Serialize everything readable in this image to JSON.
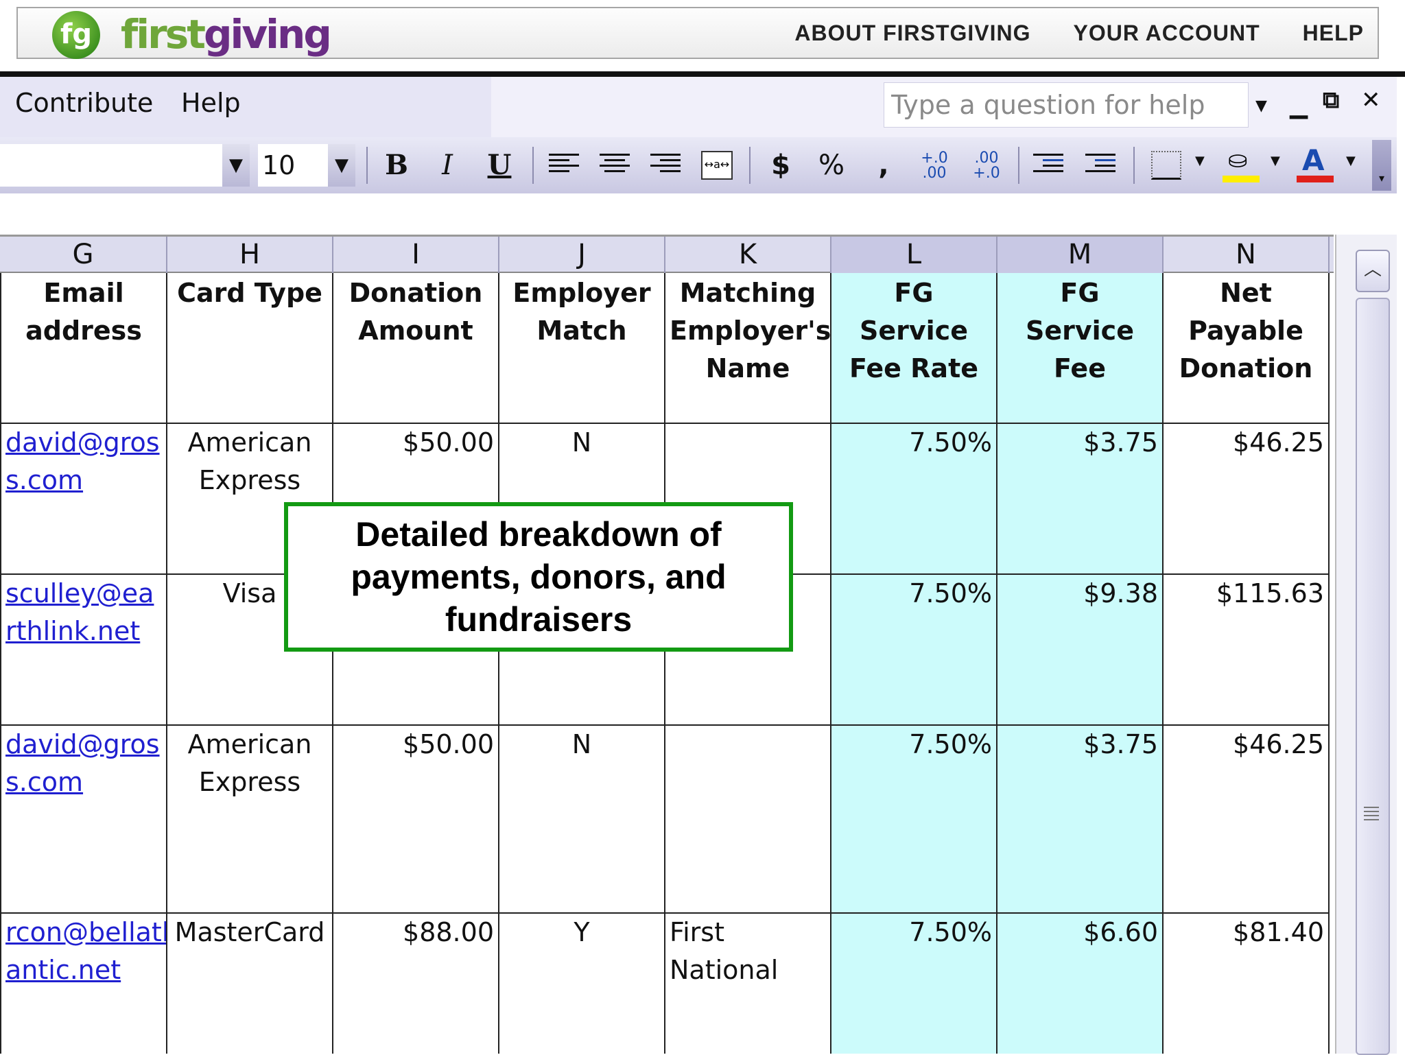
{
  "site": {
    "logo_mark": "fg",
    "logo_first": "first",
    "logo_giving": "giving",
    "nav": [
      "ABOUT FIRSTGIVING",
      "YOUR ACCOUNT",
      "HELP"
    ]
  },
  "menubar": {
    "items": [
      "Contribute",
      "Help"
    ],
    "help_placeholder": "Type a question for help",
    "window_buttons": [
      "minimize-icon",
      "restore-icon",
      "close-icon"
    ]
  },
  "toolbar": {
    "font_size": "10",
    "bold": "B",
    "italic": "I",
    "underline": "U",
    "currency": "$",
    "percent": "%",
    "comma": ",",
    "inc_decimal": "+.0 .00",
    "dec_decimal": ".00 +.0",
    "icons": [
      "align-left-icon",
      "align-center-icon",
      "align-right-icon",
      "merge-center-icon",
      "outdent-icon",
      "indent-icon",
      "borders-icon",
      "fill-color-icon",
      "font-color-icon"
    ],
    "fill_color": "#ffee00",
    "font_color": "#e0201a"
  },
  "sheet": {
    "columns": [
      "G",
      "H",
      "I",
      "J",
      "K",
      "L",
      "M",
      "N"
    ],
    "headers": [
      "Email address",
      "Card Type",
      "Donation Amount",
      "Employer Match",
      "Matching Employer's Name",
      "FG Service Fee Rate",
      "FG Service Fee",
      "Net Payable Donation"
    ],
    "rows": [
      {
        "email_1": "david@gros",
        "email_2": "s.com",
        "card_1": "American",
        "card_2": "Express",
        "donation": "$50.00",
        "match": "N",
        "employer_1": "",
        "employer_2": "",
        "rate": "7.50%",
        "fee": "$3.75",
        "net": "$46.25"
      },
      {
        "email_1": "sculley@ea",
        "email_2": "rthlink.net",
        "card_1": "Visa",
        "card_2": "",
        "donation": "",
        "match": "",
        "employer_1": "",
        "employer_2": "",
        "rate": "7.50%",
        "fee": "$9.38",
        "net": "$115.63"
      },
      {
        "email_1": "david@gros",
        "email_2": "s.com",
        "card_1": "American",
        "card_2": "Express",
        "donation": "$50.00",
        "match": "N",
        "employer_1": "",
        "employer_2": "",
        "rate": "7.50%",
        "fee": "$3.75",
        "net": "$46.25"
      },
      {
        "email_1": "rcon@bellatl",
        "email_2": "antic.net",
        "card_1": "MasterCard",
        "card_2": "",
        "donation": "$88.00",
        "match": "Y",
        "employer_1": "First",
        "employer_2": "National",
        "rate": "7.50%",
        "fee": "$6.60",
        "net": "$81.40"
      }
    ]
  },
  "callout": {
    "text": "Detailed breakdown of payments, donors, and fundraisers",
    "border_color": "#139a13"
  },
  "colors": {
    "highlight_cyan": "#ccfbfb",
    "link_blue": "#1f1fd0",
    "logo_green": "#6fa63a",
    "logo_purple": "#6a2d84"
  }
}
